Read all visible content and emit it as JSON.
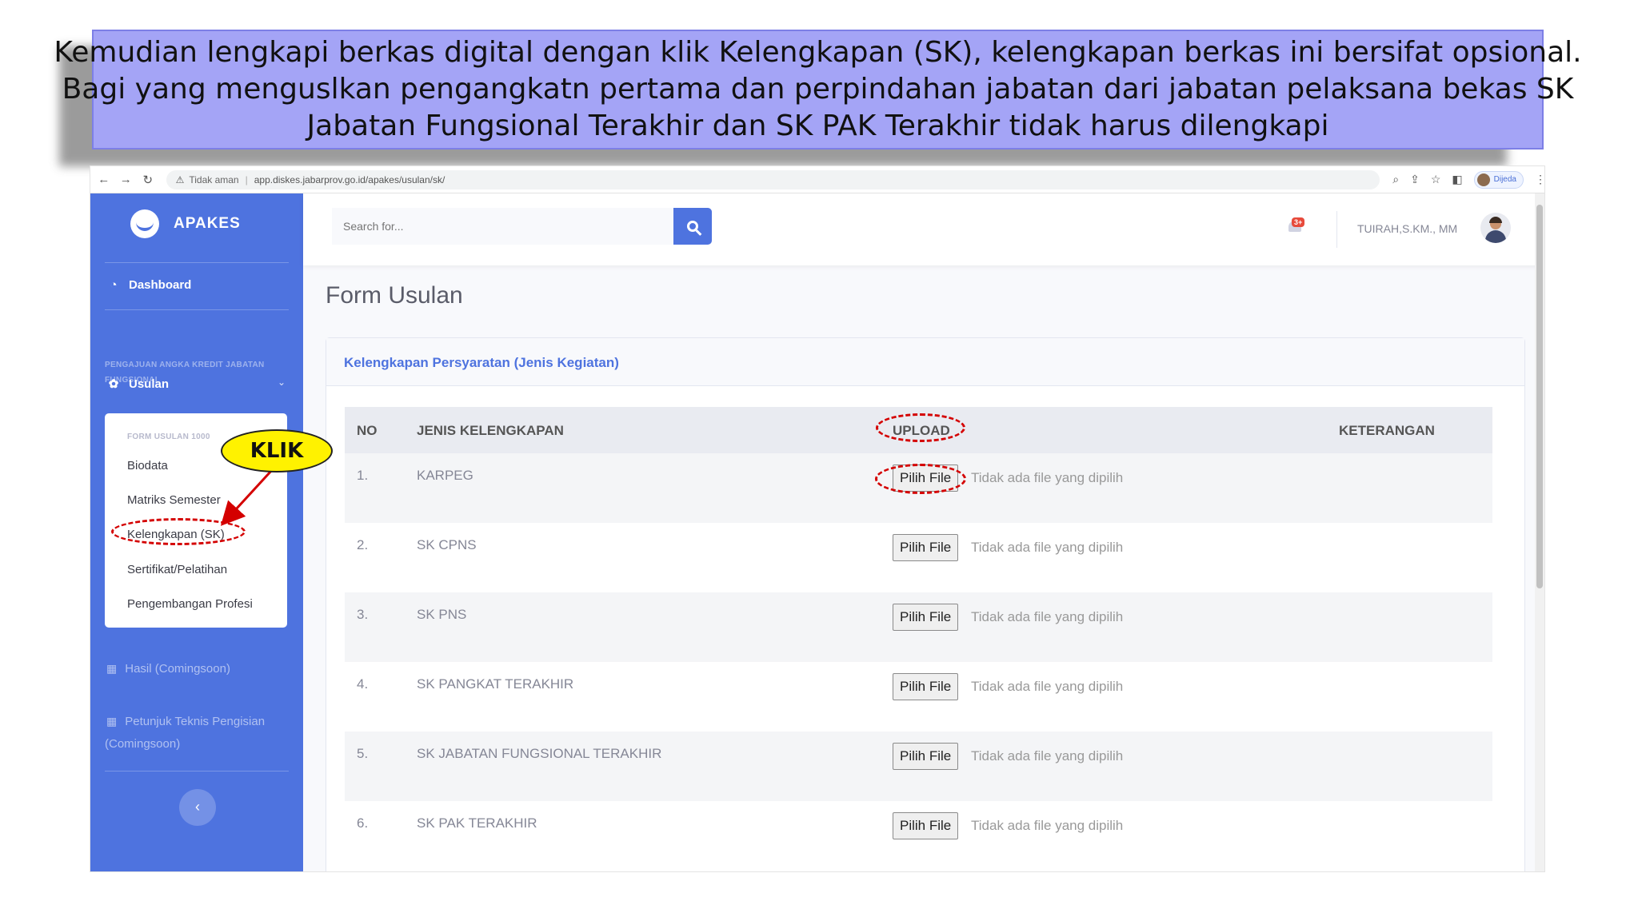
{
  "banner": {
    "line1": "Kemudian lengkapi berkas digital dengan klik Kelengkapan (SK), kelengkapan berkas ini bersifat opsional.",
    "line2": "Bagi yang menguslkan pengangkatn pertama dan perpindahan jabatan dari jabatan pelaksana bekas SK",
    "line3": "Jabatan Fungsional Terakhir dan SK PAK Terakhir tidak harus dilengkapi"
  },
  "browser": {
    "security_label": "Tidak aman",
    "url": "app.diskes.jabarprov.go.id/apakes/usulan/sk/",
    "profile_label": "Dijeda"
  },
  "sidebar": {
    "brand": "APAKES",
    "dashboard": "Dashboard",
    "heading": "PENGAJUAN ANGKA KREDIT JABATAN FUNGSIONAL",
    "usulan": "Usulan",
    "submenu_header": "FORM USULAN 1000",
    "submenu": [
      "Biodata",
      "Matriks Semester",
      "Kelengkapan (SK)",
      "Sertifikat/Pelatihan",
      "Pengembangan Profesi"
    ],
    "hasil": "Hasil (Comingsoon)",
    "petunjuk_line1": "Petunjuk Teknis Pengisian",
    "petunjuk_line2": "(Comingsoon)",
    "collapse": "‹"
  },
  "topbar": {
    "search_placeholder": "Search for...",
    "notification_badge": "3+",
    "user_name": "TUIRAH,S.KM., MM"
  },
  "main": {
    "page_title": "Form Usulan",
    "card_title": "Kelengkapan Persyaratan (Jenis Kegiatan)",
    "columns": [
      "NO",
      "JENIS KELENGKAPAN",
      "UPLOAD",
      "KETERANGAN"
    ],
    "file_button": "Pilih File",
    "file_status": "Tidak ada file yang dipilih",
    "rows": [
      {
        "no": "1.",
        "jenis": "KARPEG"
      },
      {
        "no": "2.",
        "jenis": "SK CPNS"
      },
      {
        "no": "3.",
        "jenis": "SK PNS"
      },
      {
        "no": "4.",
        "jenis": "SK PANGKAT TERAKHIR"
      },
      {
        "no": "5.",
        "jenis": "SK JABATAN FUNGSIONAL TERAKHIR"
      },
      {
        "no": "6.",
        "jenis": "SK PAK TERAKHIR"
      }
    ]
  },
  "annotation": {
    "callout": "KLIK",
    "color": "#d40000"
  },
  "colors": {
    "banner_bg": "#a4a4f6",
    "sidebar_bg": "#4e73df",
    "accent": "#4e73df",
    "callout_bg": "#fff200"
  }
}
